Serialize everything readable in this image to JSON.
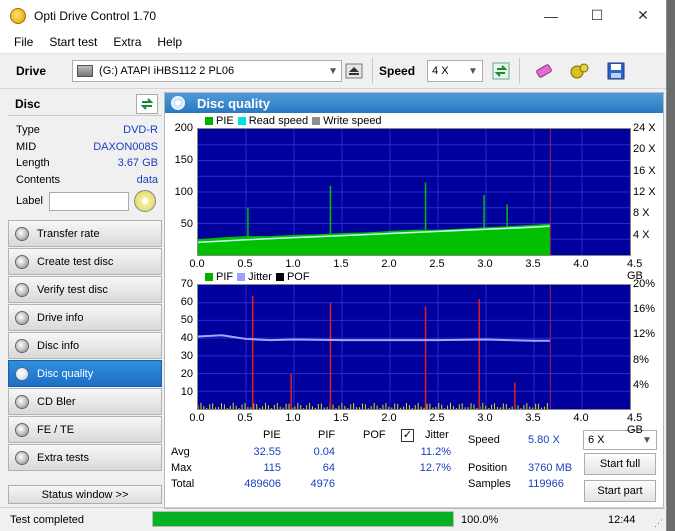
{
  "app": {
    "title": "Opti Drive Control 1.70"
  },
  "window_controls": {
    "minimize": "—",
    "maximize": "☐",
    "close": "✕"
  },
  "menu": [
    "File",
    "Start test",
    "Extra",
    "Help"
  ],
  "toolbar": {
    "drive_label": "Drive",
    "drive_value": "(G:)   ATAPI iHBS112   2 PL06",
    "speed_label": "Speed",
    "speed_value": "4 X"
  },
  "disc": {
    "heading": "Disc",
    "rows": [
      {
        "key": "Type",
        "value": "DVD-R"
      },
      {
        "key": "MID",
        "value": "DAXON008S"
      },
      {
        "key": "Length",
        "value": "3.67 GB"
      },
      {
        "key": "Contents",
        "value": "data"
      }
    ],
    "label_key": "Label"
  },
  "nav": [
    {
      "label": "Transfer rate",
      "active": false
    },
    {
      "label": "Create test disc",
      "active": false
    },
    {
      "label": "Verify test disc",
      "active": false
    },
    {
      "label": "Drive info",
      "active": false
    },
    {
      "label": "Disc info",
      "active": false
    },
    {
      "label": "Disc quality",
      "active": true
    },
    {
      "label": "CD Bler",
      "active": false
    },
    {
      "label": "FE / TE",
      "active": false
    },
    {
      "label": "Extra tests",
      "active": false
    }
  ],
  "status_window": "Status window >>",
  "panel_title": "Disc quality",
  "chart_data": [
    {
      "type": "area",
      "legend": [
        {
          "name": "PIE",
          "color": "#00b000"
        },
        {
          "name": "Read speed",
          "color": "#00e0e0"
        },
        {
          "name": "Write speed",
          "color": "#909090"
        }
      ],
      "x_ticks": [
        "0.0",
        "0.5",
        "1.0",
        "1.5",
        "2.0",
        "2.5",
        "3.0",
        "3.5",
        "4.0",
        "4.5 GB"
      ],
      "xlim": [
        0,
        4.5
      ],
      "y_left_ticks": [
        "200",
        "150",
        "100",
        "50"
      ],
      "ylim": [
        0,
        200
      ],
      "y_right_ticks": [
        "24 X",
        "20 X",
        "16 X",
        "12 X",
        "8 X",
        "4 X"
      ],
      "y2lim": [
        0,
        24
      ],
      "series": [
        {
          "name": "PIE",
          "x": [
            0,
            0.25,
            0.5,
            0.75,
            1.0,
            1.25,
            1.5,
            1.75,
            2.0,
            2.25,
            2.5,
            2.75,
            3.0,
            3.25,
            3.5,
            3.67
          ],
          "y": [
            25,
            28,
            30,
            30,
            32,
            33,
            35,
            36,
            38,
            40,
            40,
            42,
            44,
            46,
            48,
            50
          ]
        },
        {
          "name": "Read speed",
          "x": [
            0,
            0.5,
            1.0,
            1.5,
            2.0,
            2.5,
            3.0,
            3.5,
            3.67
          ],
          "y": [
            2.4,
            2.9,
            3.3,
            3.7,
            4.1,
            4.5,
            4.9,
            5.3,
            5.5
          ]
        }
      ],
      "spikes": [
        {
          "x": 1.38,
          "y": 110
        },
        {
          "x": 2.37,
          "y": 115
        },
        {
          "x": 2.98,
          "y": 95
        },
        {
          "x": 0.52,
          "y": 75
        },
        {
          "x": 3.22,
          "y": 80
        }
      ]
    },
    {
      "type": "bar",
      "legend": [
        {
          "name": "PIF",
          "color": "#00b000"
        },
        {
          "name": "Jitter",
          "color": "#9aa0ff"
        },
        {
          "name": "POF",
          "color": "#000000"
        }
      ],
      "x_ticks": [
        "0.0",
        "0.5",
        "1.0",
        "1.5",
        "2.0",
        "2.5",
        "3.0",
        "3.5",
        "4.0",
        "4.5 GB"
      ],
      "xlim": [
        0,
        4.5
      ],
      "y_left_ticks": [
        "70",
        "60",
        "50",
        "40",
        "30",
        "20",
        "10"
      ],
      "ylim": [
        0,
        70
      ],
      "y_right_ticks": [
        "20%",
        "16%",
        "12%",
        "8%",
        "4%"
      ],
      "y2lim": [
        0,
        20
      ],
      "jitter": {
        "x": [
          0,
          0.25,
          0.5,
          0.75,
          1.0,
          1.5,
          2.0,
          2.5,
          3.0,
          3.5,
          3.67
        ],
        "y": [
          11.7,
          11.9,
          11.3,
          11.1,
          11.2,
          11.1,
          11.1,
          11.1,
          11.2,
          11.0,
          11.0
        ]
      },
      "pif_spikes": [
        {
          "x": 0.57,
          "y": 64
        },
        {
          "x": 1.38,
          "y": 60
        },
        {
          "x": 2.37,
          "y": 58
        },
        {
          "x": 2.93,
          "y": 62
        },
        {
          "x": 0.97,
          "y": 20
        },
        {
          "x": 3.3,
          "y": 15
        }
      ]
    }
  ],
  "stats": {
    "columns": [
      "PIE",
      "PIF",
      "POF",
      "Jitter"
    ],
    "rows": [
      {
        "label": "Avg",
        "pie": "32.55",
        "pif": "0.04",
        "pof": "",
        "jitter": "11.2%"
      },
      {
        "label": "Max",
        "pie": "115",
        "pif": "64",
        "pof": "",
        "jitter": "12.7%"
      },
      {
        "label": "Total",
        "pie": "489606",
        "pif": "4976",
        "pof": "",
        "jitter": ""
      }
    ],
    "jitter_checked": "✓",
    "speed_label": "Speed",
    "speed_value": "5.80 X",
    "position_label": "Position",
    "position_value": "3760 MB",
    "samples_label": "Samples",
    "samples_value": "119966"
  },
  "controls": {
    "speed_select": "6 X",
    "start_full": "Start full",
    "start_part": "Start part"
  },
  "statusbar": {
    "text": "Test completed",
    "progress": 1.0,
    "progress_text": "100.0%",
    "time": "12:44"
  }
}
